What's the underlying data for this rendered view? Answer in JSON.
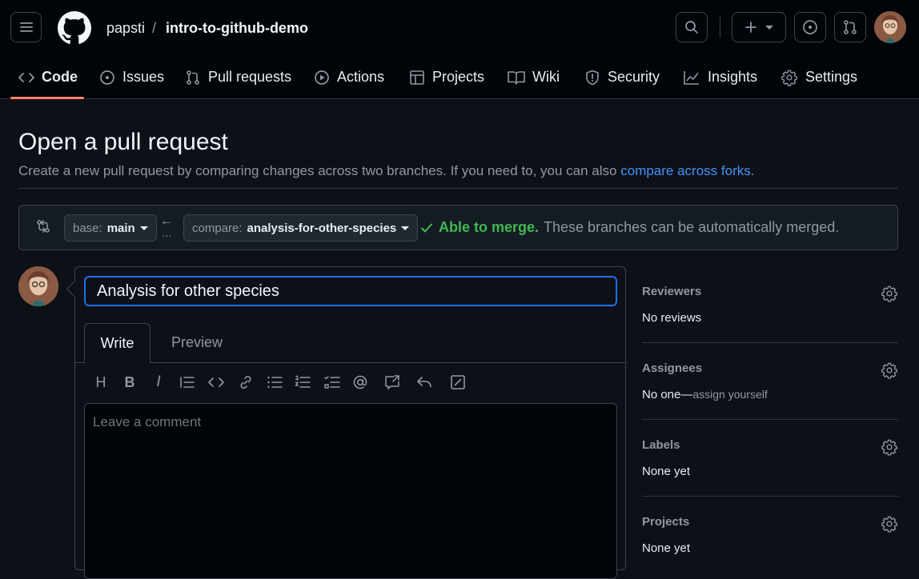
{
  "header": {
    "owner": "papsti",
    "separator": "/",
    "repo": "intro-to-github-demo"
  },
  "tabs": [
    {
      "label": "Code",
      "icon": "code-icon"
    },
    {
      "label": "Issues",
      "icon": "issue-opened-icon"
    },
    {
      "label": "Pull requests",
      "icon": "git-pull-request-icon"
    },
    {
      "label": "Actions",
      "icon": "play-icon"
    },
    {
      "label": "Projects",
      "icon": "table-icon"
    },
    {
      "label": "Wiki",
      "icon": "book-icon"
    },
    {
      "label": "Security",
      "icon": "shield-icon"
    },
    {
      "label": "Insights",
      "icon": "graph-icon"
    },
    {
      "label": "Settings",
      "icon": "gear-icon"
    }
  ],
  "page": {
    "title": "Open a pull request",
    "subtitle": "Create a new pull request by comparing changes across two branches. If you need to, you can also",
    "subtitle_link": "compare across forks",
    "subtitle_end": "."
  },
  "compare": {
    "base_prefix": "base:",
    "base_branch": "main",
    "compare_prefix": "compare:",
    "compare_branch": "analysis-for-other-species",
    "merge_status": "Able to merge.",
    "merge_detail": "These branches can be automatically merged.",
    "status_color": "#3fb950"
  },
  "form": {
    "title_value": "Analysis for other species",
    "write_tab": "Write",
    "preview_tab": "Preview",
    "comment_placeholder": "Leave a comment"
  },
  "sidebar": {
    "reviewers": {
      "label": "Reviewers",
      "value": "No reviews"
    },
    "assignees": {
      "label": "Assignees",
      "value": "No one—",
      "link": "assign yourself"
    },
    "labels": {
      "label": "Labels",
      "value": "None yet"
    },
    "projects": {
      "label": "Projects",
      "value": "None yet"
    }
  },
  "colors": {
    "accent": "#4493f8",
    "tab_underline": "#f78166",
    "focus_border": "#1f6feb"
  }
}
